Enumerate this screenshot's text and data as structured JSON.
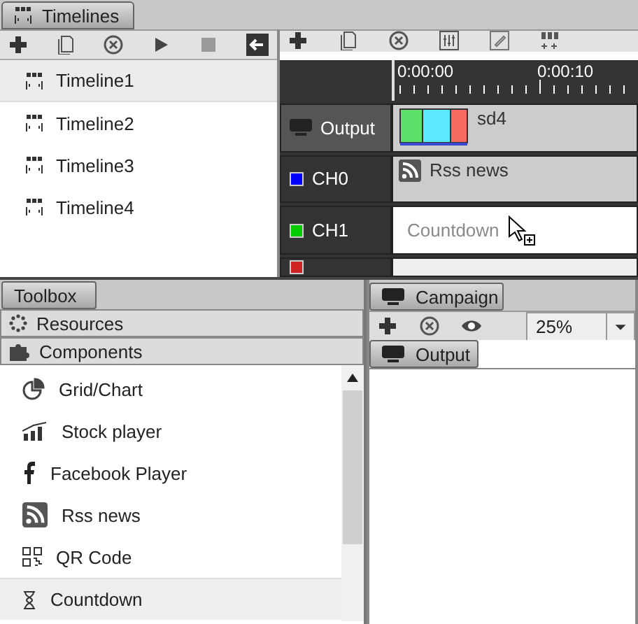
{
  "top_tab": {
    "label": "Timelines"
  },
  "timelines": [
    {
      "name": "Timeline1",
      "selected": true
    },
    {
      "name": "Timeline2",
      "selected": false
    },
    {
      "name": "Timeline3",
      "selected": false
    },
    {
      "name": "Timeline4",
      "selected": false
    }
  ],
  "timeline_view": {
    "ruler": [
      "0:00:00",
      "0:00:10"
    ],
    "tracks": [
      {
        "kind": "output",
        "name": "Output",
        "clip": {
          "kind": "preview",
          "label": "sd4"
        }
      },
      {
        "kind": "channel",
        "name": "CH0",
        "color": "#0000ff",
        "clip": {
          "kind": "rss",
          "label": "Rss news"
        }
      },
      {
        "kind": "channel",
        "name": "CH1",
        "color": "#00cc00",
        "clip": {
          "kind": "ghost",
          "label": "Countdown"
        }
      },
      {
        "kind": "channel",
        "color": "#cc2222"
      }
    ]
  },
  "toolbox": {
    "tab": "Toolbox",
    "sections": [
      {
        "kind": "resources",
        "label": "Resources"
      },
      {
        "kind": "components",
        "label": "Components"
      }
    ],
    "components": [
      {
        "kind": "chart",
        "label": "Grid/Chart",
        "selected": false
      },
      {
        "kind": "stock",
        "label": "Stock player",
        "selected": false
      },
      {
        "kind": "facebook",
        "label": "Facebook Player",
        "selected": false
      },
      {
        "kind": "rss",
        "label": "Rss news",
        "selected": false
      },
      {
        "kind": "qr",
        "label": "QR Code",
        "selected": false
      },
      {
        "kind": "countdown",
        "label": "Countdown",
        "selected": true
      }
    ]
  },
  "campaign": {
    "tab": "Campaign",
    "zoom": "25%",
    "output_tab": "Output"
  }
}
